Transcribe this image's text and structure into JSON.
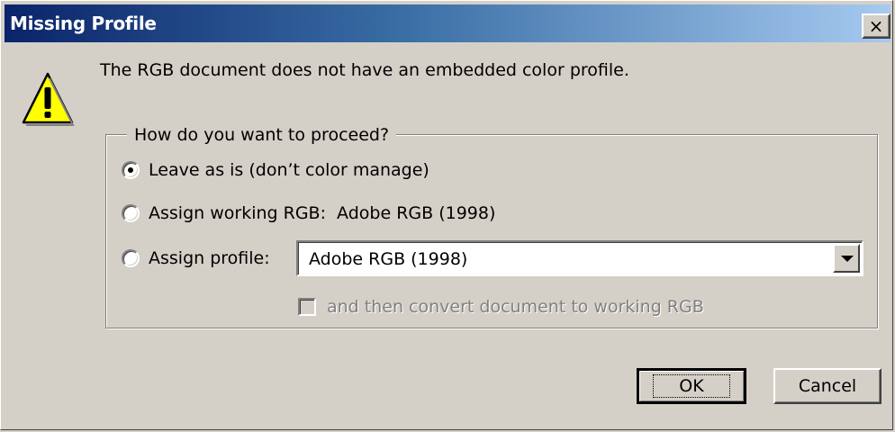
{
  "window": {
    "title": "Missing Profile",
    "close_glyph": "×"
  },
  "message": "The RGB document does not have an embedded color profile.",
  "group": {
    "legend": "How do you want to proceed?",
    "options": [
      {
        "label": "Leave as is (don’t color manage)",
        "checked": true
      },
      {
        "label": "Assign working RGB:  Adobe RGB (1998)",
        "checked": false
      },
      {
        "label": "Assign profile:",
        "checked": false
      }
    ],
    "profile_select": {
      "value": "Adobe RGB (1998)"
    },
    "convert_checkbox": {
      "label": "and then convert document to working RGB",
      "checked": false,
      "disabled": true
    }
  },
  "buttons": {
    "ok": "OK",
    "cancel": "Cancel"
  },
  "icons": {
    "warning": "warning-icon",
    "close": "close-icon",
    "dropdown": "chevron-down-icon"
  },
  "colors": {
    "title_start": "#0a246a",
    "title_end": "#a6caf0",
    "face": "#d4d0c8",
    "warning_fill": "#ffff00"
  }
}
